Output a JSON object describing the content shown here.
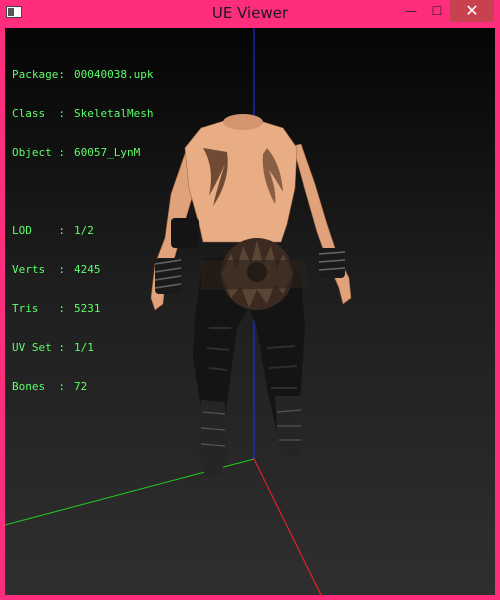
{
  "window": {
    "title": "UE Viewer",
    "minimize_glyph": "—",
    "maximize_glyph": "☐",
    "close_glyph": "✕",
    "icon": "app-window-icon"
  },
  "info": {
    "package_label": "Package:",
    "package_value": "00040038.upk",
    "class_label": "Class  :",
    "class_value": "SkeletalMesh",
    "object_label": "Object :",
    "object_value": "60057_LynM",
    "lod_label": "LOD    :",
    "lod_value": "1/2",
    "verts_label": "Verts  :",
    "verts_value": "4245",
    "tris_label": "Tris   :",
    "tris_value": "5231",
    "uvset_label": "UV Set :",
    "uvset_value": "1/1",
    "bones_label": "Bones  :",
    "bones_value": "72"
  },
  "colors": {
    "frame": "#ff2d7e",
    "info_text": "#5cff6a",
    "axis_x": "#ff2020",
    "axis_y": "#20d020",
    "axis_z": "#2030ff"
  }
}
